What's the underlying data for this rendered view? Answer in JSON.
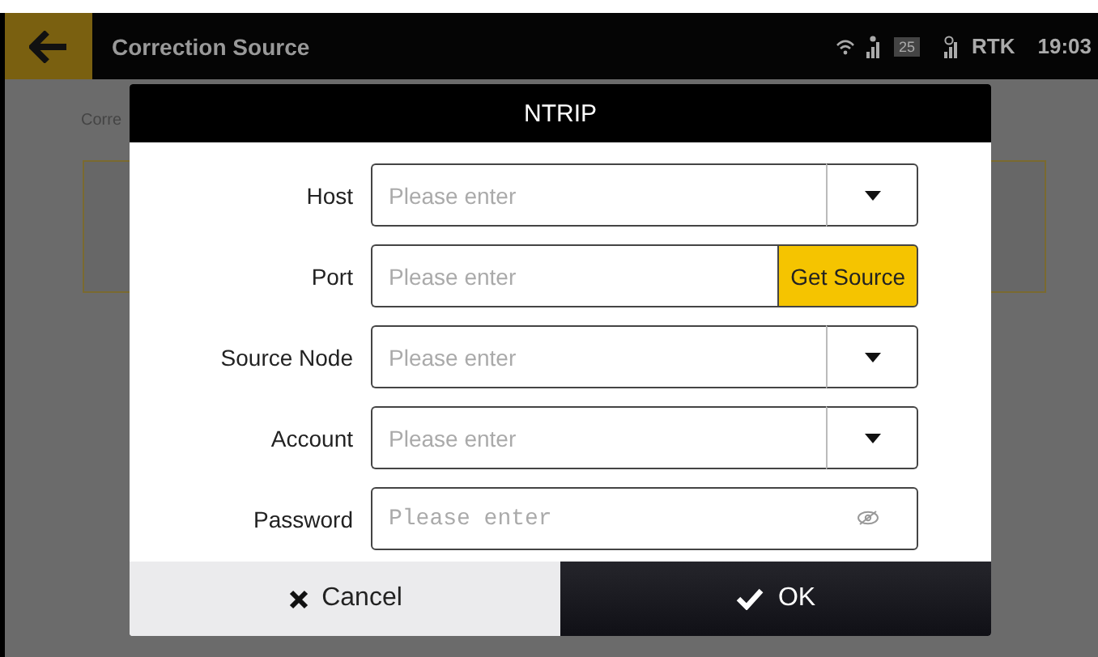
{
  "status_bar": {
    "title": "Correction Source",
    "satellites": "25",
    "mode": "RTK",
    "time": "19:03"
  },
  "background": {
    "breadcrumb": "Corre"
  },
  "dialog": {
    "title": "NTRIP",
    "fields": [
      {
        "label": "Host",
        "kind": "dropdown",
        "placeholder": "Please enter"
      },
      {
        "label": "Port",
        "kind": "button",
        "placeholder": "Please enter",
        "button": "Get Source"
      },
      {
        "label": "Source Node",
        "kind": "dropdown",
        "placeholder": "Please enter"
      },
      {
        "label": "Account",
        "kind": "dropdown",
        "placeholder": "Please enter"
      },
      {
        "label": "Password",
        "kind": "password",
        "placeholder": "Please enter"
      }
    ],
    "buttons": [
      {
        "label": "Cancel",
        "kind": "cancel"
      },
      {
        "label": "OK",
        "kind": "ok"
      }
    ]
  }
}
